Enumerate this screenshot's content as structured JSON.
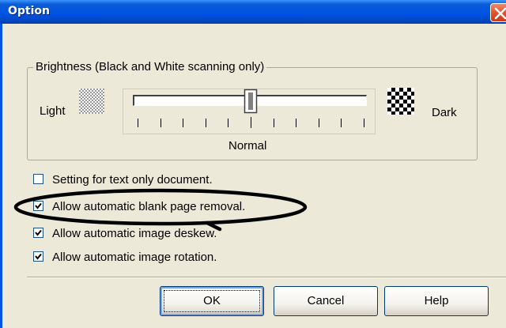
{
  "window": {
    "title": "Option"
  },
  "brightness": {
    "group_label": "Brightness (Black and White scanning only)",
    "light_label": "Light",
    "dark_label": "Dark",
    "normal_label": "Normal",
    "slider_position": 0.5,
    "tick_count": 11
  },
  "options": [
    {
      "label": "Setting for text only document.",
      "checked": false
    },
    {
      "label": "Allow automatic blank page removal.",
      "checked": true
    },
    {
      "label": "Allow automatic image deskew.",
      "checked": true
    },
    {
      "label": "Allow automatic image rotation.",
      "checked": true
    }
  ],
  "buttons": {
    "ok": "OK",
    "cancel": "Cancel",
    "help": "Help"
  },
  "colors": {
    "titlebar": "#0054e3",
    "dialog_bg": "#ece9d8",
    "annotation_ring": "#000000"
  }
}
